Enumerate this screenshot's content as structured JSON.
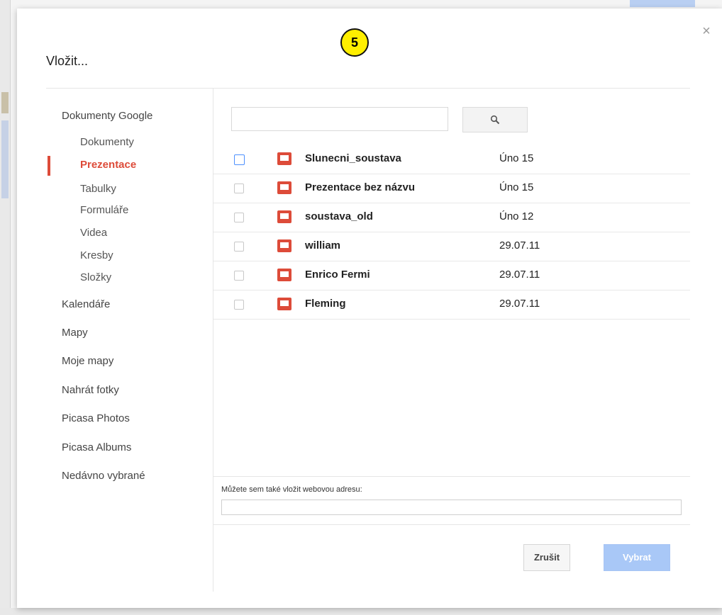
{
  "dialog": {
    "title": "Vložit...",
    "close_label": "×",
    "step_badge": "5"
  },
  "sidebar": {
    "groups": [
      {
        "label": "Dokumenty Google",
        "items": [
          {
            "label": "Dokumenty",
            "active": false
          },
          {
            "label": "Prezentace",
            "active": true
          },
          {
            "label": "Tabulky",
            "active": false
          },
          {
            "label": "Formuláře",
            "active": false
          },
          {
            "label": "Videa",
            "active": false
          },
          {
            "label": "Kresby",
            "active": false
          },
          {
            "label": "Složky",
            "active": false
          }
        ]
      }
    ],
    "items": [
      {
        "label": "Kalendáře"
      },
      {
        "label": "Mapy"
      },
      {
        "label": "Moje mapy"
      },
      {
        "label": "Nahrát fotky"
      },
      {
        "label": "Picasa Photos"
      },
      {
        "label": "Picasa Albums"
      },
      {
        "label": "Nedávno vybrané"
      }
    ]
  },
  "search": {
    "value": "",
    "placeholder": "",
    "button_icon": "search-icon"
  },
  "files": [
    {
      "name": "Slunecni_soustava",
      "date": "Úno 15",
      "icon": "presentation-icon",
      "checked": false
    },
    {
      "name": "Prezentace bez názvu",
      "date": "Úno 15",
      "icon": "presentation-icon",
      "checked": false
    },
    {
      "name": "soustava_old",
      "date": "Úno 12",
      "icon": "presentation-icon",
      "checked": false
    },
    {
      "name": "william",
      "date": "29.07.11",
      "icon": "presentation-icon",
      "checked": false
    },
    {
      "name": "Enrico Fermi",
      "date": "29.07.11",
      "icon": "presentation-icon",
      "checked": false
    },
    {
      "name": "Fleming",
      "date": "29.07.11",
      "icon": "presentation-icon",
      "checked": false
    }
  ],
  "url": {
    "label": "Můžete sem také vložit webovou adresu:",
    "value": ""
  },
  "footer": {
    "cancel_label": "Zrušit",
    "select_label": "Vybrat"
  },
  "colors": {
    "accent_red": "#dd4b39",
    "select_button_disabled": "#a9c8f7",
    "badge_yellow": "#ffef00"
  }
}
